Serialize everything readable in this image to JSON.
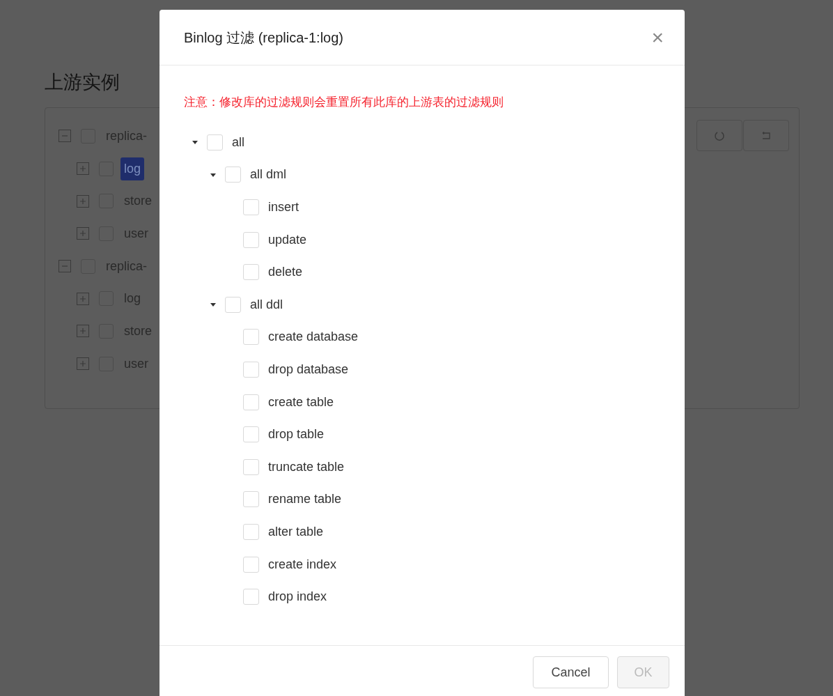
{
  "page": {
    "title": "上游实例",
    "instances": [
      {
        "label": "replica-",
        "expanded": true,
        "checked": false,
        "selected": false,
        "children": [
          {
            "label": "log",
            "expanded": false,
            "checked": false,
            "selected": true
          },
          {
            "label": "store",
            "expanded": false,
            "checked": false,
            "selected": false
          },
          {
            "label": "user",
            "expanded": false,
            "checked": false,
            "selected": false
          }
        ]
      },
      {
        "label": "replica-",
        "expanded": true,
        "checked": false,
        "selected": false,
        "children": [
          {
            "label": "log",
            "expanded": false,
            "checked": false,
            "selected": false
          },
          {
            "label": "store",
            "expanded": false,
            "checked": false,
            "selected": false
          },
          {
            "label": "user",
            "expanded": false,
            "checked": false,
            "selected": false
          }
        ]
      }
    ]
  },
  "dialog": {
    "title": "Binlog 过滤 (replica-1:log)",
    "close": "×",
    "warning": "注意：修改库的过滤规则会重置所有此库的上游表的过滤规则",
    "filters": [
      {
        "label": "all",
        "expanded": true,
        "checked": false,
        "children": [
          {
            "label": "all dml",
            "expanded": true,
            "checked": false,
            "children": [
              {
                "label": "insert",
                "checked": false
              },
              {
                "label": "update",
                "checked": false
              },
              {
                "label": "delete",
                "checked": false
              }
            ]
          },
          {
            "label": "all ddl",
            "expanded": true,
            "checked": false,
            "children": [
              {
                "label": "create database",
                "checked": false
              },
              {
                "label": "drop database",
                "checked": false
              },
              {
                "label": "create table",
                "checked": false
              },
              {
                "label": "drop table",
                "checked": false
              },
              {
                "label": "truncate table",
                "checked": false
              },
              {
                "label": "rename table",
                "checked": false
              },
              {
                "label": "alter table",
                "checked": false
              },
              {
                "label": "create index",
                "checked": false
              },
              {
                "label": "drop index",
                "checked": false
              }
            ]
          }
        ]
      }
    ],
    "buttons": [
      {
        "label": "Cancel",
        "disabled": false
      },
      {
        "label": "OK",
        "disabled": true
      }
    ]
  }
}
